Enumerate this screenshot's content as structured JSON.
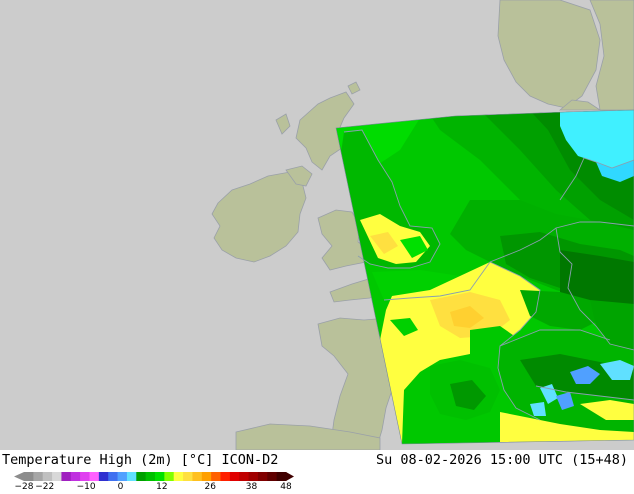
{
  "map": {
    "model": "ICON-D2",
    "variable": "Temperature High (2m)",
    "unit": "°C",
    "colors": {
      "background_sea": "#cccccc",
      "land_outside_domain": "#b9c19a",
      "coastline": "#9aa0a8",
      "border": "#8a9fb0"
    }
  },
  "footer": {
    "title": "Temperature High (2m) [°C] ICON-D2",
    "datetime": "Su 08-02-2026 15:00 UTC (15+48)"
  },
  "legend": {
    "tick_labels": [
      "-28",
      "-22",
      "-10",
      "0",
      "12",
      "26",
      "38",
      "48"
    ],
    "colors": [
      "#8c8c8c",
      "#a6a6a6",
      "#c0c0c0",
      "#d8d8d8",
      "#a020c0",
      "#c030e0",
      "#e040f0",
      "#ff60ff",
      "#3030d0",
      "#4070f0",
      "#50a0ff",
      "#60e0ff",
      "#00a000",
      "#00c000",
      "#00e000",
      "#80ff00",
      "#ffff40",
      "#ffe040",
      "#ffc020",
      "#ffa000",
      "#ff6000",
      "#ff2000",
      "#e00000",
      "#c00000",
      "#a00000",
      "#800000",
      "#600000",
      "#400000"
    ]
  }
}
